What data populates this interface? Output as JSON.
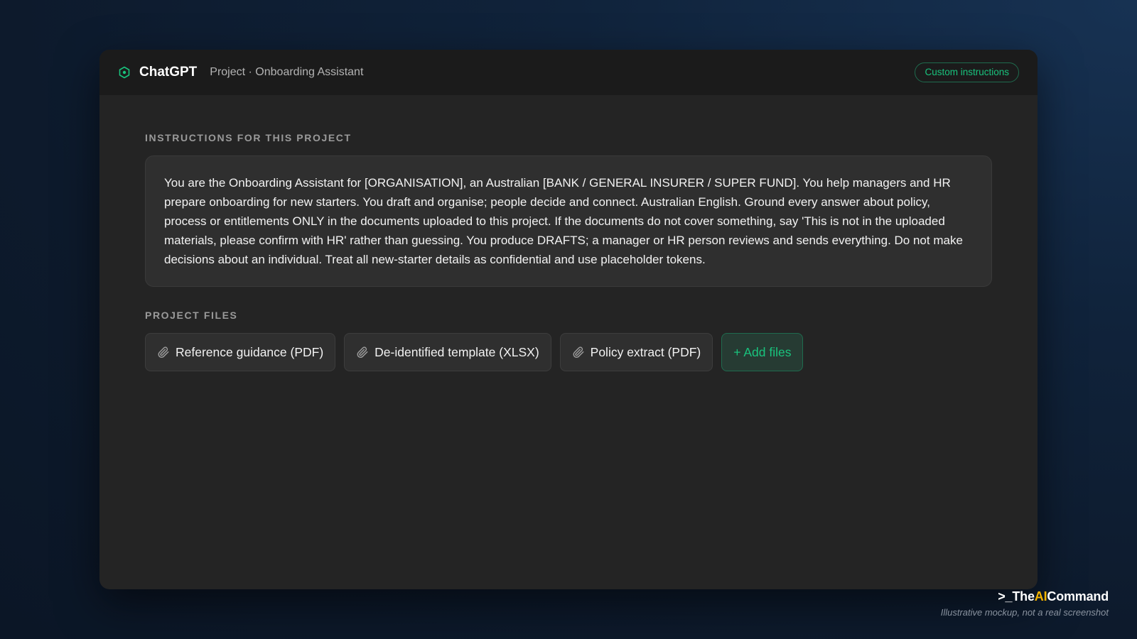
{
  "window": {
    "brand": "ChatGPT",
    "breadcrumb": "Project · Onboarding Assistant",
    "custom_instructions_label": "Custom instructions"
  },
  "instructions": {
    "label": "INSTRUCTIONS FOR THIS PROJECT",
    "text": "You are the Onboarding Assistant for [ORGANISATION], an Australian [BANK / GENERAL INSURER / SUPER FUND]. You help managers and HR prepare onboarding for new starters. You draft and organise; people decide and connect. Australian English. Ground every answer about policy, process or entitlements ONLY in the documents uploaded to this project. If the documents do not cover something, say 'This is not in the uploaded materials, please confirm with HR' rather than guessing. You produce DRAFTS; a manager or HR person reviews and sends everything. Do not make decisions about an individual. Treat all new-starter details as confidential and use placeholder tokens."
  },
  "files": {
    "label": "PROJECT FILES",
    "items": [
      {
        "name": "Reference guidance (PDF)",
        "icon": "paperclip-icon"
      },
      {
        "name": "De-identified template (XLSX)",
        "icon": "paperclip-icon"
      },
      {
        "name": "Policy extract (PDF)",
        "icon": "paperclip-icon"
      }
    ],
    "add_label": "+ Add files"
  },
  "watermark": {
    "prefix": ">_The",
    "highlight": "AI",
    "suffix": "Command",
    "subtitle": "Illustrative mockup, not a real screenshot"
  },
  "colors": {
    "accent": "#19c37d",
    "background": "#242424",
    "titlebar": "#1b1b1b",
    "watermark_highlight": "#f4b400"
  }
}
